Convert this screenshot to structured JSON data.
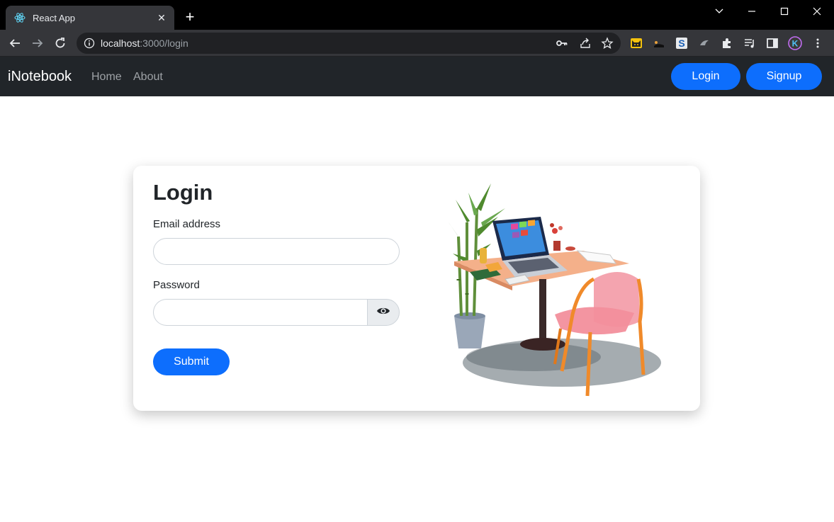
{
  "browser": {
    "tab_title": "React App",
    "url_host": "localhost",
    "url_path": ":3000/login"
  },
  "navbar": {
    "brand": "iNotebook",
    "links": [
      "Home",
      "About"
    ],
    "login_label": "Login",
    "signup_label": "Signup"
  },
  "form": {
    "title": "Login",
    "email_label": "Email address",
    "email_value": "",
    "password_label": "Password",
    "password_value": "",
    "submit_label": "Submit"
  },
  "colors": {
    "primary": "#0d6efd",
    "navbar_bg": "#212529"
  }
}
